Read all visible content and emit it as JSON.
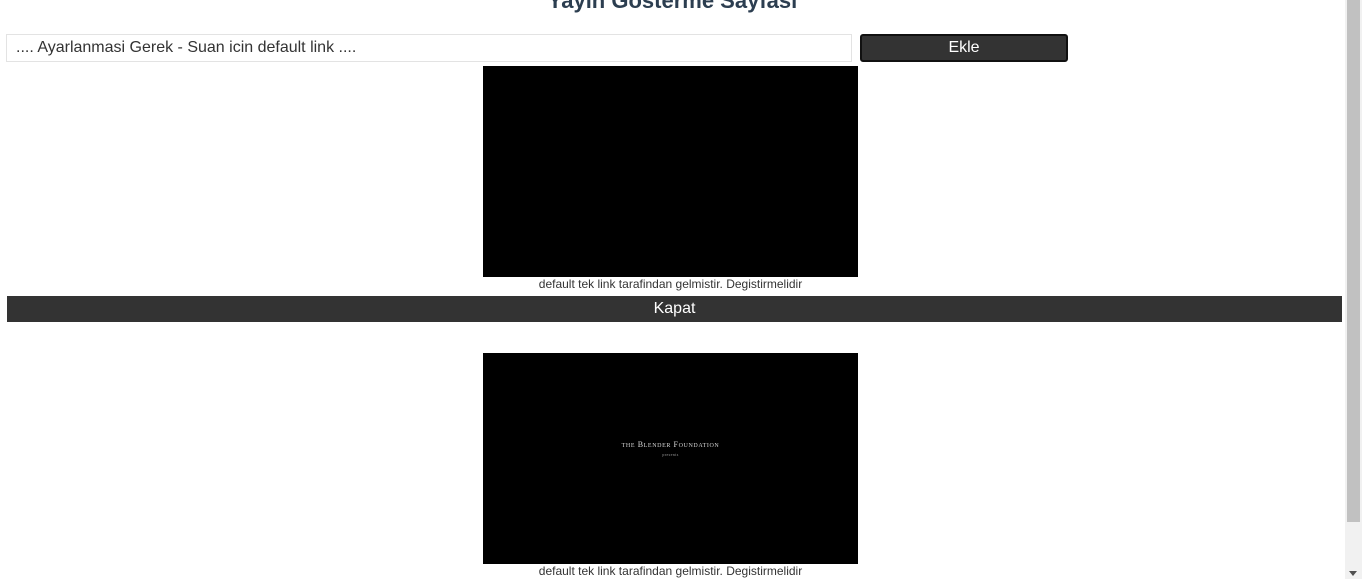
{
  "page": {
    "title": "Yayin Gosterme Sayfasi"
  },
  "form": {
    "url_placeholder": ".... Ayarlanmasi Gerek - Suan icin default link ....",
    "add_button_label": "Ekle"
  },
  "streams": [
    {
      "caption": "default tek link tarafindan gelmistir. Degistirmelidir",
      "frame_text": "",
      "frame_subtext": ""
    },
    {
      "caption": "default tek link tarafindan gelmistir. Degistirmelidir",
      "frame_text": "the Blender Foundation",
      "frame_subtext": "presents"
    }
  ],
  "close_bar": {
    "label": "Kapat"
  },
  "colors": {
    "title": "#2c3e50",
    "button_bg": "#333333",
    "video_bg": "#000000"
  }
}
